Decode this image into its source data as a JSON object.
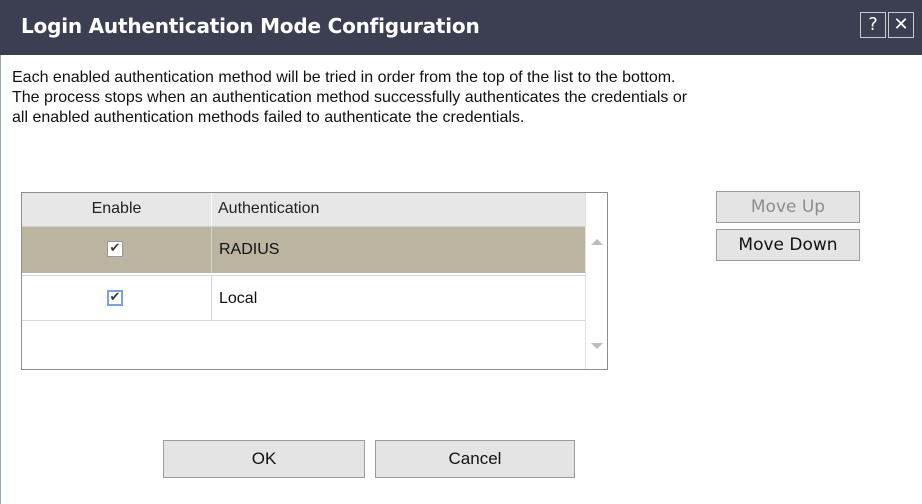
{
  "dialog": {
    "title": "Login Authentication Mode Configuration",
    "help_icon": "help-icon",
    "help_label": "?",
    "close_icon": "close-icon",
    "close_label": "✕"
  },
  "description": {
    "lines": [
      "Each enabled authentication method will be tried in order from the top of the list to the bottom.",
      "The process stops when an authentication method successfully authenticates the credentials or",
      "all enabled authentication methods failed to authenticate the credentials."
    ]
  },
  "table": {
    "columns": [
      "Enable",
      "Authentication"
    ],
    "rows": [
      {
        "enabled": true,
        "check": "✔",
        "authentication": "RADIUS",
        "selected": true
      },
      {
        "enabled": true,
        "check": "✔",
        "authentication": "Local",
        "selected": false
      }
    ],
    "scroll_up_icon": "scroll-up-arrow-icon",
    "scroll_down_icon": "scroll-down-arrow-icon"
  },
  "buttons": {
    "move_up": "Move Up",
    "move_down": "Move Down",
    "ok": "OK",
    "cancel": "Cancel"
  },
  "colors": {
    "title_bar": "#3c3f51",
    "selected_row": "#bab4a0",
    "header_bg": "#e7e7e7",
    "disabled_text": "#8d8d8d"
  }
}
